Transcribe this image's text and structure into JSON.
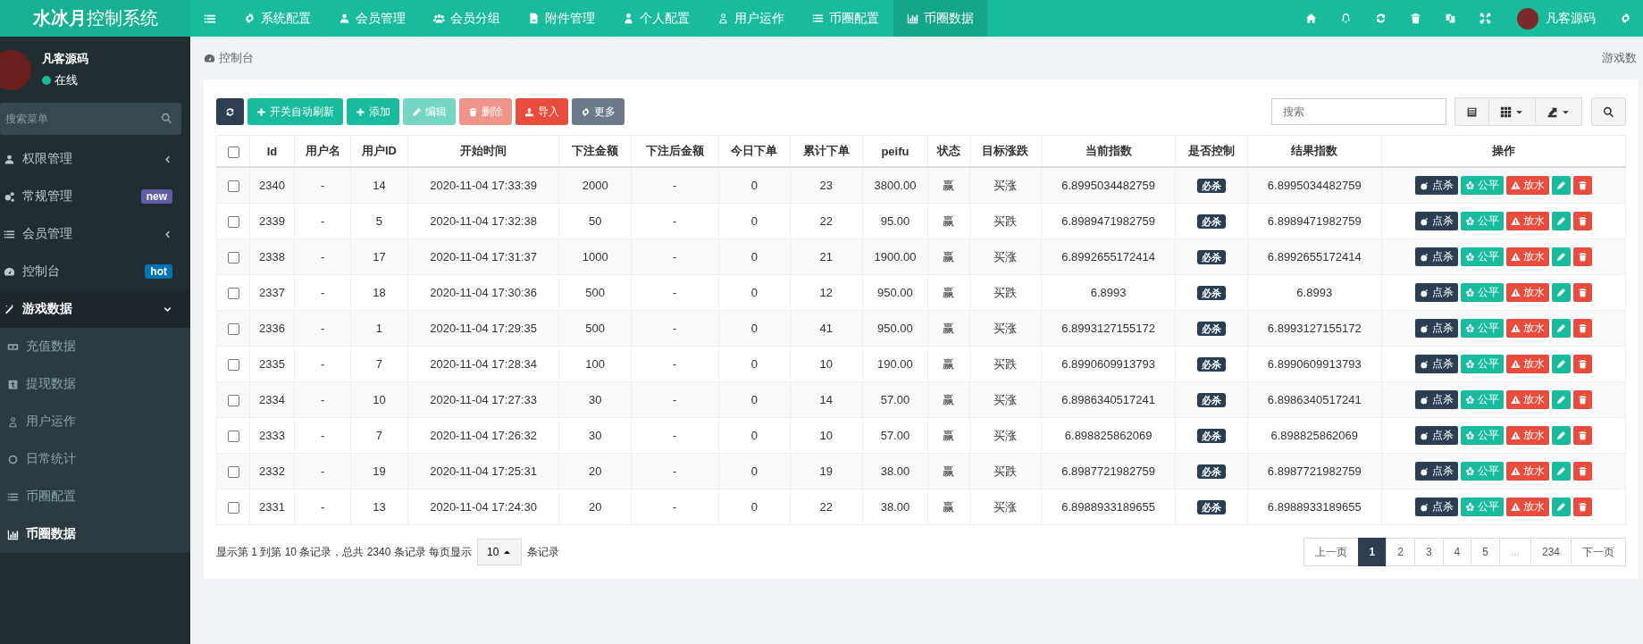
{
  "navbar": {
    "logo_bold": "水冰月",
    "logo_rest": "控制系统",
    "menu": [
      {
        "label": "系统配置",
        "selected": false
      },
      {
        "label": "会员管理",
        "selected": false
      },
      {
        "label": "会员分组",
        "selected": false
      },
      {
        "label": "附件管理",
        "selected": false
      },
      {
        "label": "个人配置",
        "selected": false
      },
      {
        "label": "用户运作",
        "selected": false
      },
      {
        "label": "币圈配置",
        "selected": false
      },
      {
        "label": "币圈数据",
        "selected": true
      }
    ],
    "user": "凡客源码"
  },
  "sidebar": {
    "user": {
      "name": "凡客源码",
      "status": "在线"
    },
    "search": {
      "placeholder": "搜索菜单"
    },
    "items": [
      {
        "label": "权限管理",
        "expanded": false
      },
      {
        "label": "常规管理",
        "badge": "new",
        "color": "#605ca8"
      },
      {
        "label": "会员管理",
        "expanded": false
      },
      {
        "label": "控制台",
        "badge": "hot",
        "color": "#0073b7"
      },
      {
        "label": "游戏数据",
        "expanded": true,
        "children": [
          {
            "label": "充值数据",
            "selected": false
          },
          {
            "label": "提现数据",
            "selected": false
          },
          {
            "label": "用户运作",
            "selected": false
          },
          {
            "label": "日常统计",
            "selected": false
          },
          {
            "label": "币圈配置",
            "selected": false
          },
          {
            "label": "币圈数据",
            "selected": true
          }
        ]
      }
    ]
  },
  "breadcrumb": {
    "current": "控制台",
    "right": "游戏数"
  },
  "toolbar": {
    "buttons": [
      {
        "kind": "refresh",
        "disabled": false
      },
      {
        "kind": "toggle",
        "label": "开关自动刷新",
        "disabled": false
      },
      {
        "kind": "add",
        "label": "添加",
        "disabled": false
      },
      {
        "kind": "edit",
        "label": "编辑",
        "disabled": true
      },
      {
        "kind": "delete",
        "label": "删除",
        "disabled": true
      },
      {
        "kind": "import",
        "label": "导入",
        "disabled": false
      },
      {
        "kind": "more",
        "label": "更多",
        "disabled": false
      }
    ],
    "search": {
      "placeholder": "搜索"
    }
  },
  "table": {
    "select_all": {
      "checked": false
    },
    "columns": [
      "Id",
      "用户名",
      "用户ID",
      "开始时间",
      "下注金额",
      "下注后金额",
      "今日下单",
      "累计下单",
      "peifu",
      "状态",
      "目标涨跌",
      "当前指数",
      "是否控制",
      "结果指数",
      "操作"
    ],
    "rows": [
      {
        "checked": false,
        "cells": [
          "2340",
          "-",
          "14",
          "2020-11-04 17:33:39",
          "2000",
          "-",
          "0",
          "23",
          "3800.00",
          "赢",
          "买涨",
          "6.8995034482759",
          "必杀",
          "6.8995034482759"
        ],
        "actions": [
          "点杀",
          "公平",
          "放水"
        ]
      },
      {
        "checked": false,
        "cells": [
          "2339",
          "-",
          "5",
          "2020-11-04 17:32:38",
          "50",
          "-",
          "0",
          "22",
          "95.00",
          "赢",
          "买跌",
          "6.8989471982759",
          "必杀",
          "6.8989471982759"
        ],
        "actions": [
          "点杀",
          "公平",
          "放水"
        ]
      },
      {
        "checked": false,
        "cells": [
          "2338",
          "-",
          "17",
          "2020-11-04 17:31:37",
          "1000",
          "-",
          "0",
          "21",
          "1900.00",
          "赢",
          "买涨",
          "6.8992655172414",
          "必杀",
          "6.8992655172414"
        ],
        "actions": [
          "点杀",
          "公平",
          "放水"
        ]
      },
      {
        "checked": false,
        "cells": [
          "2337",
          "-",
          "18",
          "2020-11-04 17:30:36",
          "500",
          "-",
          "0",
          "12",
          "950.00",
          "赢",
          "买跌",
          "6.8993",
          "必杀",
          "6.8993"
        ],
        "actions": [
          "点杀",
          "公平",
          "放水"
        ]
      },
      {
        "checked": false,
        "cells": [
          "2336",
          "-",
          "1",
          "2020-11-04 17:29:35",
          "500",
          "-",
          "0",
          "41",
          "950.00",
          "赢",
          "买涨",
          "6.8993127155172",
          "必杀",
          "6.8993127155172"
        ],
        "actions": [
          "点杀",
          "公平",
          "放水"
        ]
      },
      {
        "checked": false,
        "cells": [
          "2335",
          "-",
          "7",
          "2020-11-04 17:28:34",
          "100",
          "-",
          "0",
          "10",
          "190.00",
          "赢",
          "买跌",
          "6.8990609913793",
          "必杀",
          "6.8990609913793"
        ],
        "actions": [
          "点杀",
          "公平",
          "放水"
        ]
      },
      {
        "checked": false,
        "cells": [
          "2334",
          "-",
          "10",
          "2020-11-04 17:27:33",
          "30",
          "-",
          "0",
          "14",
          "57.00",
          "赢",
          "买涨",
          "6.8986340517241",
          "必杀",
          "6.8986340517241"
        ],
        "actions": [
          "点杀",
          "公平",
          "放水"
        ]
      },
      {
        "checked": false,
        "cells": [
          "2333",
          "-",
          "7",
          "2020-11-04 17:26:32",
          "30",
          "-",
          "0",
          "10",
          "57.00",
          "赢",
          "买涨",
          "6.898825862069",
          "必杀",
          "6.898825862069"
        ],
        "actions": [
          "点杀",
          "公平",
          "放水"
        ]
      },
      {
        "checked": false,
        "cells": [
          "2332",
          "-",
          "19",
          "2020-11-04 17:25:31",
          "20",
          "-",
          "0",
          "19",
          "38.00",
          "赢",
          "买跌",
          "6.8987721982759",
          "必杀",
          "6.8987721982759"
        ],
        "actions": [
          "点杀",
          "公平",
          "放水"
        ]
      },
      {
        "checked": false,
        "cells": [
          "2331",
          "-",
          "13",
          "2020-11-04 17:24:30",
          "20",
          "-",
          "0",
          "22",
          "38.00",
          "赢",
          "买涨",
          "6.8988933189655",
          "必杀",
          "6.8988933189655"
        ],
        "actions": [
          "点杀",
          "公平",
          "放水"
        ]
      }
    ]
  },
  "pagination": {
    "info": "显示第 1 到第 10 条记录，总共 2340 条记录 每页显示",
    "page_size": "10",
    "suffix": "条记录",
    "pages": [
      {
        "label": "上一页",
        "selected": false,
        "disabled": false
      },
      {
        "label": "1",
        "selected": true,
        "disabled": false
      },
      {
        "label": "2",
        "selected": false,
        "disabled": false
      },
      {
        "label": "3",
        "selected": false,
        "disabled": false
      },
      {
        "label": "4",
        "selected": false,
        "disabled": false
      },
      {
        "label": "5",
        "selected": false,
        "disabled": false
      },
      {
        "label": "...",
        "selected": false,
        "disabled": true
      },
      {
        "label": "234",
        "selected": false,
        "disabled": false
      },
      {
        "label": "下一页",
        "selected": false,
        "disabled": false
      }
    ]
  }
}
